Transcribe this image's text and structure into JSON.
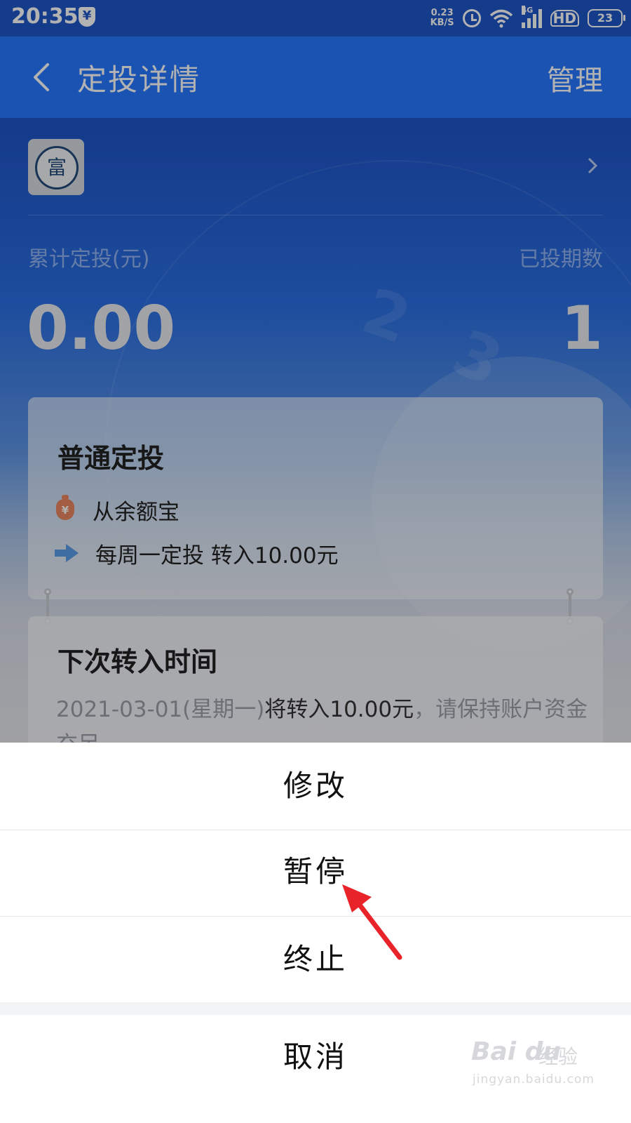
{
  "status_bar": {
    "time": "20:35",
    "net_speed_value": "0.23",
    "net_speed_unit": "KB/S",
    "network_type": "4G",
    "hd": "HD",
    "battery": "23"
  },
  "nav": {
    "title": "定投详情",
    "manage_label": "管理"
  },
  "summary": {
    "total_label": "累计定投(元)",
    "total_value": "0.00",
    "periods_label": "已投期数",
    "periods_value": "1"
  },
  "plan_card": {
    "title": "普通定投",
    "source": "从余额宝",
    "frequency": "每周一定投 转入10.00元"
  },
  "next_card": {
    "title": "下次转入时间",
    "text_date": "2021-03-01(星期一)",
    "text_action": "将转入10.00元",
    "text_tail": "，请保持账户资金充足"
  },
  "action_sheet": {
    "edit": "修改",
    "pause": "暂停",
    "stop": "终止",
    "cancel": "取消"
  },
  "watermark": {
    "logo": "Bai du",
    "text": "经验",
    "url": "jingyan.baidu.com"
  },
  "colors": {
    "nav_blue": "#2677ff",
    "status_blue": "#1f56c8",
    "arrow_red": "#e8232a",
    "moneybag_orange": "#e8865f",
    "transfer_arrow_blue": "#5a9ce8"
  },
  "icons": [
    "shield-yen-icon",
    "clock-icon",
    "wifi-icon",
    "signal-icon",
    "battery-icon",
    "back-arrow-icon",
    "chevron-right-icon",
    "moneybag-icon",
    "right-arrow-icon"
  ]
}
